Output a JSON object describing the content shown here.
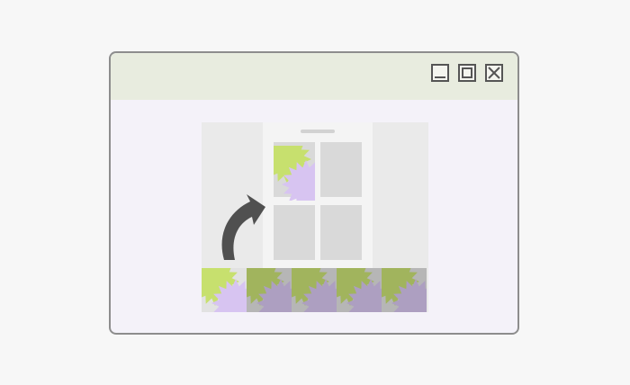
{
  "window": {
    "controls": [
      {
        "name": "minimize-button",
        "icon": "minimize-icon"
      },
      {
        "name": "maximize-button",
        "icon": "maximize-icon"
      },
      {
        "name": "close-button",
        "icon": "close-icon"
      }
    ]
  },
  "illustration": {
    "phone_grid_slots": 4,
    "filled_slots": 1,
    "thumbnail_strip_count": 5,
    "selected_thumbnail": 1,
    "arrow_icon": "curved-arrow-icon",
    "colors": {
      "lime": "#c7e06e",
      "lavender": "#d7c4f1",
      "slot": "#d9d9d9",
      "panel": "#eaeaea",
      "phone": "#f4f4f4",
      "arrow": "#505050"
    }
  }
}
